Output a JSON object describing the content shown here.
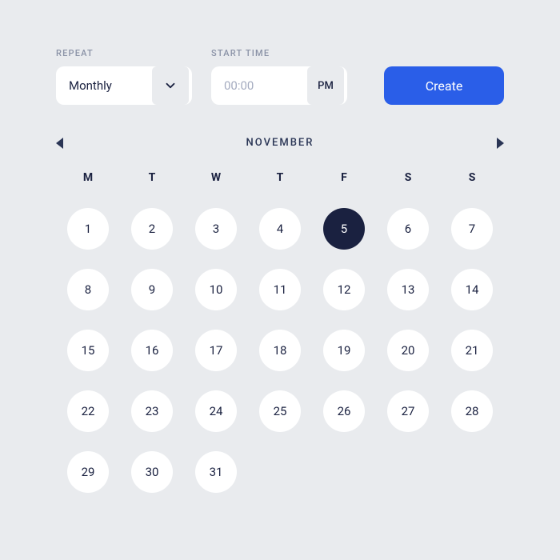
{
  "repeat": {
    "label": "REPEAT",
    "value": "Monthly"
  },
  "startTime": {
    "label": "START TIME",
    "value": "00:00",
    "suffix": "PM"
  },
  "createButton": {
    "label": "Create"
  },
  "calendar": {
    "month": "NOVEMBER",
    "weekdays": [
      "M",
      "T",
      "W",
      "T",
      "F",
      "S",
      "S"
    ],
    "selectedDay": 5,
    "days": [
      1,
      2,
      3,
      4,
      5,
      6,
      7,
      8,
      9,
      10,
      11,
      12,
      13,
      14,
      15,
      16,
      17,
      18,
      19,
      20,
      21,
      22,
      23,
      24,
      25,
      26,
      27,
      28,
      29,
      30,
      31
    ]
  }
}
